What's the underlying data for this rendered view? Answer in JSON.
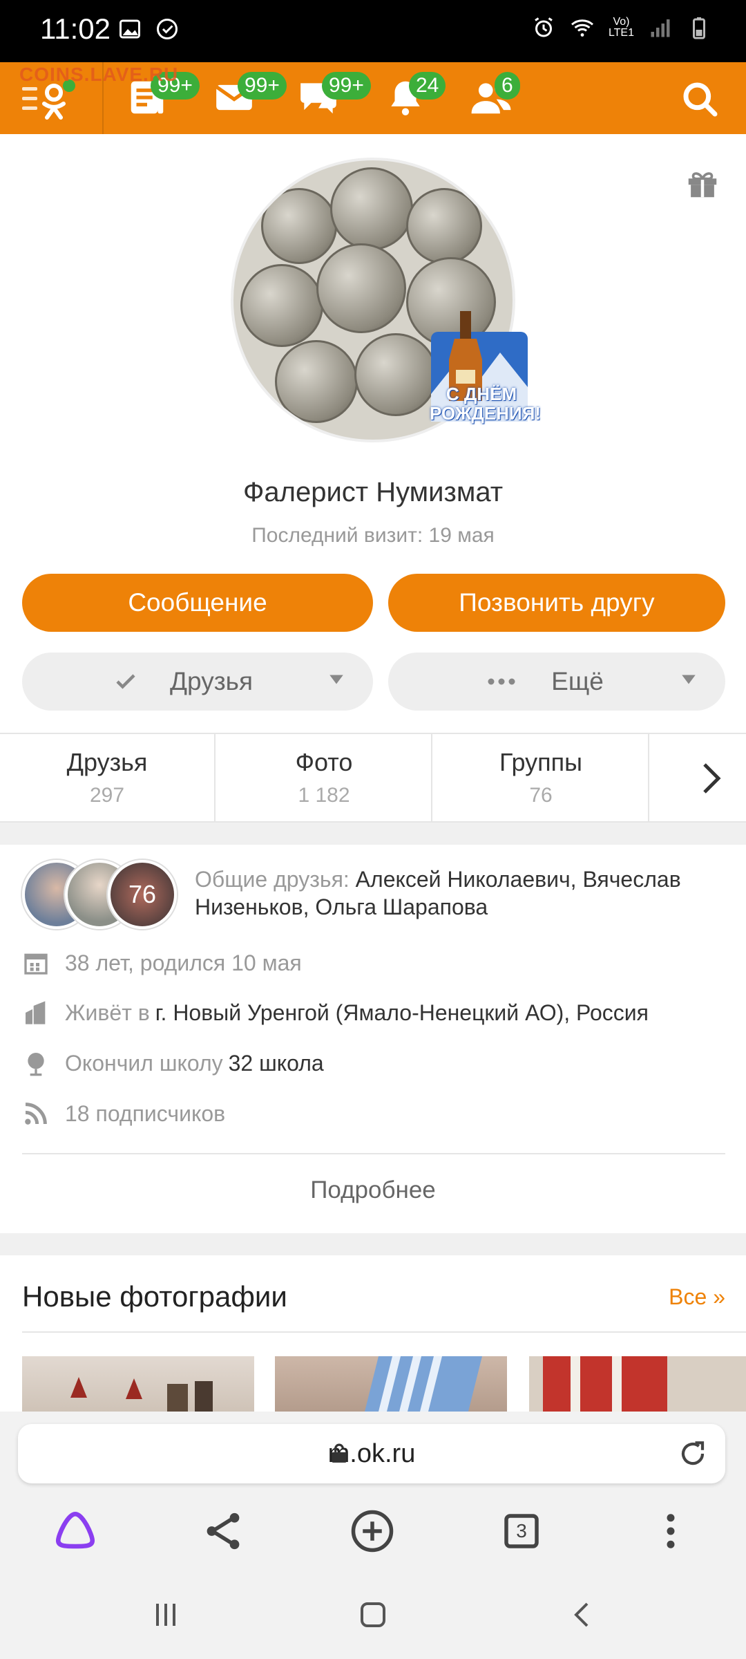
{
  "status_bar": {
    "time": "11:02",
    "network_label_top": "Vo)",
    "network_label_bottom": "LTE1"
  },
  "toolbar": {
    "watermark": "COINS.LAVE.RU",
    "badges": {
      "feed": "99+",
      "messages": "99+",
      "discussions": "99+",
      "notifications": "24",
      "guests": "6"
    },
    "accent": "#ee8208",
    "badge_color": "#3cae3a"
  },
  "profile": {
    "name": "Фалерист Нумизмат",
    "last_visit": "Последний визит: 19 мая",
    "birthday_sticker": "С ДНЁМ РОЖДЕНИЯ!",
    "buttons": {
      "message": "Сообщение",
      "call": "Позвонить другу",
      "friends": "Друзья",
      "more": "Ещё"
    }
  },
  "stats": [
    {
      "label": "Друзья",
      "value": "297"
    },
    {
      "label": "Фото",
      "value": "1 182"
    },
    {
      "label": "Группы",
      "value": "76"
    }
  ],
  "info": {
    "mutual_count": "76",
    "mutual_label": "Общие друзья:",
    "mutual_names": "Алексей Николаевич, Вячеслав Низеньков, Ольга Шарапова",
    "age": "38 лет, родился 10 мая",
    "lives_label": "Живёт в",
    "lives_value": "г. Новый Уренгой (Ямало-Ненецкий АО), Россия",
    "school_label": "Окончил школу",
    "school_value": "32 школа",
    "subscribers": "18 подписчиков",
    "more_link": "Подробнее"
  },
  "new_photos": {
    "title": "Новые фотографии",
    "all_link": "Все »"
  },
  "browser": {
    "url": "m.ok.ru",
    "tabs_count": "3"
  }
}
